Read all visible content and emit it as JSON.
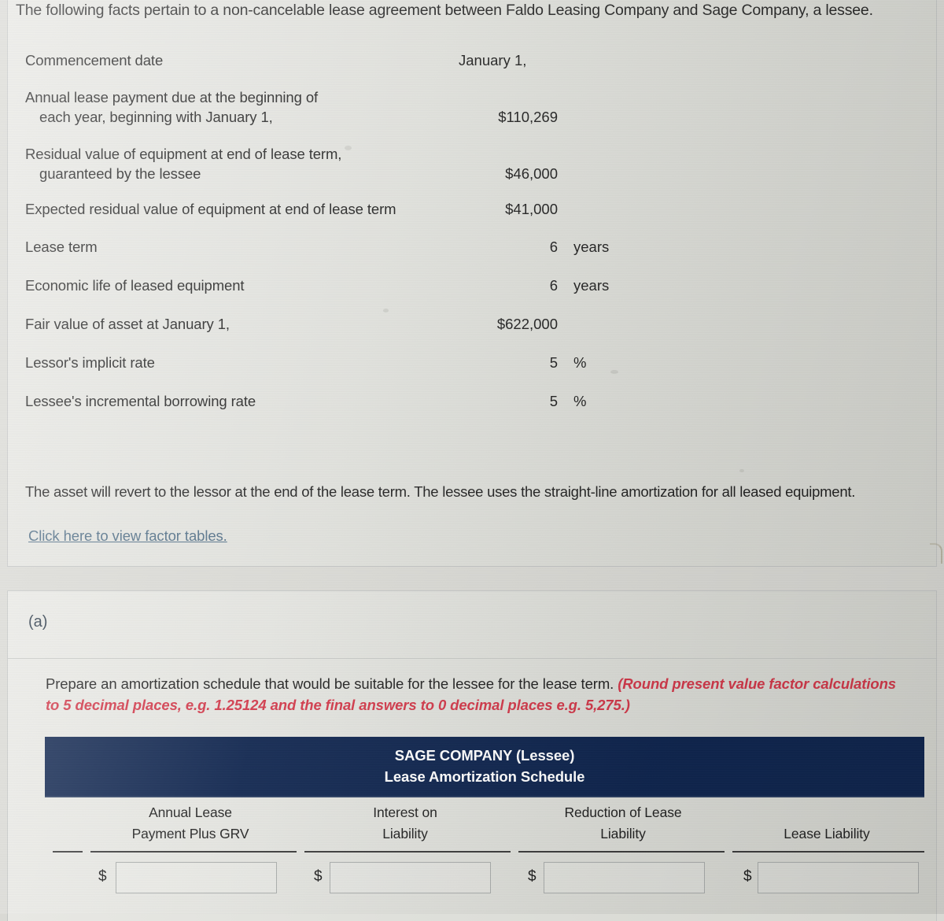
{
  "intro": {
    "text": "The following facts pertain to a non-cancelable lease agreement between Faldo Leasing Company and Sage Company, a lessee."
  },
  "facts": [
    {
      "label_line1": "Commencement date",
      "label_line2": "",
      "value": "January 1,",
      "unit": "",
      "align": "left"
    },
    {
      "label_line1": "Annual lease payment due at the beginning of",
      "label_line2": "each year, beginning with January 1,",
      "value": "$110,269",
      "unit": "",
      "align": "right"
    },
    {
      "label_line1": "Residual value of equipment at end of lease term,",
      "label_line2": "guaranteed by the lessee",
      "value": "$46,000",
      "unit": "",
      "align": "right"
    },
    {
      "label_line1": "Expected residual value of equipment at end of lease term",
      "label_line2": "",
      "value": "$41,000",
      "unit": "",
      "align": "right"
    },
    {
      "label_line1": "Lease term",
      "label_line2": "",
      "value": "6",
      "unit": "years",
      "align": "right"
    },
    {
      "label_line1": "Economic life of leased equipment",
      "label_line2": "",
      "value": "6",
      "unit": "years",
      "align": "right"
    },
    {
      "label_line1": "Fair value of asset at January 1,",
      "label_line2": "",
      "value": "$622,000",
      "unit": "",
      "align": "right"
    },
    {
      "label_line1": "Lessor's implicit rate",
      "label_line2": "",
      "value": "5",
      "unit": "%",
      "align": "right"
    },
    {
      "label_line1": "Lessee's incremental borrowing rate",
      "label_line2": "",
      "value": "5",
      "unit": "%",
      "align": "right"
    }
  ],
  "revert_note": "The asset will revert to the lessor at the end of the lease term. The lessee uses the straight-line amortization for all leased equipment.",
  "factor_tables_link": "Click here to view factor tables.",
  "part": {
    "letter": "(a)",
    "prompt_plain": "Prepare an amortization schedule that would be suitable for the lessee for the lease term. ",
    "prompt_emphasis": "(Round present value factor calculations to 5 decimal places, e.g. 1.25124 and the final answers to 0 decimal places e.g. 5,275.)"
  },
  "schedule": {
    "title_line1": "SAGE COMPANY (Lessee)",
    "title_line2": "Lease Amortization Schedule",
    "columns": [
      {
        "head_line1": "Annual Lease",
        "head_line2": "Payment Plus GRV"
      },
      {
        "head_line1": "Interest on",
        "head_line2": "Liability"
      },
      {
        "head_line1": "Reduction of Lease",
        "head_line2": "Liability"
      },
      {
        "head_line1": "",
        "head_line2": "Lease Liability"
      }
    ],
    "currency_symbol": "$",
    "row_inputs": [
      {
        "value": "",
        "placeholder": ""
      },
      {
        "value": "",
        "placeholder": ""
      },
      {
        "value": "",
        "placeholder": ""
      },
      {
        "value": "",
        "placeholder": ""
      }
    ]
  },
  "colors": {
    "header_navy": "#10264f",
    "emphasis_red": "#d1394a",
    "link_blue": "#4f6d85",
    "page_bg": "#d9d9d4"
  }
}
